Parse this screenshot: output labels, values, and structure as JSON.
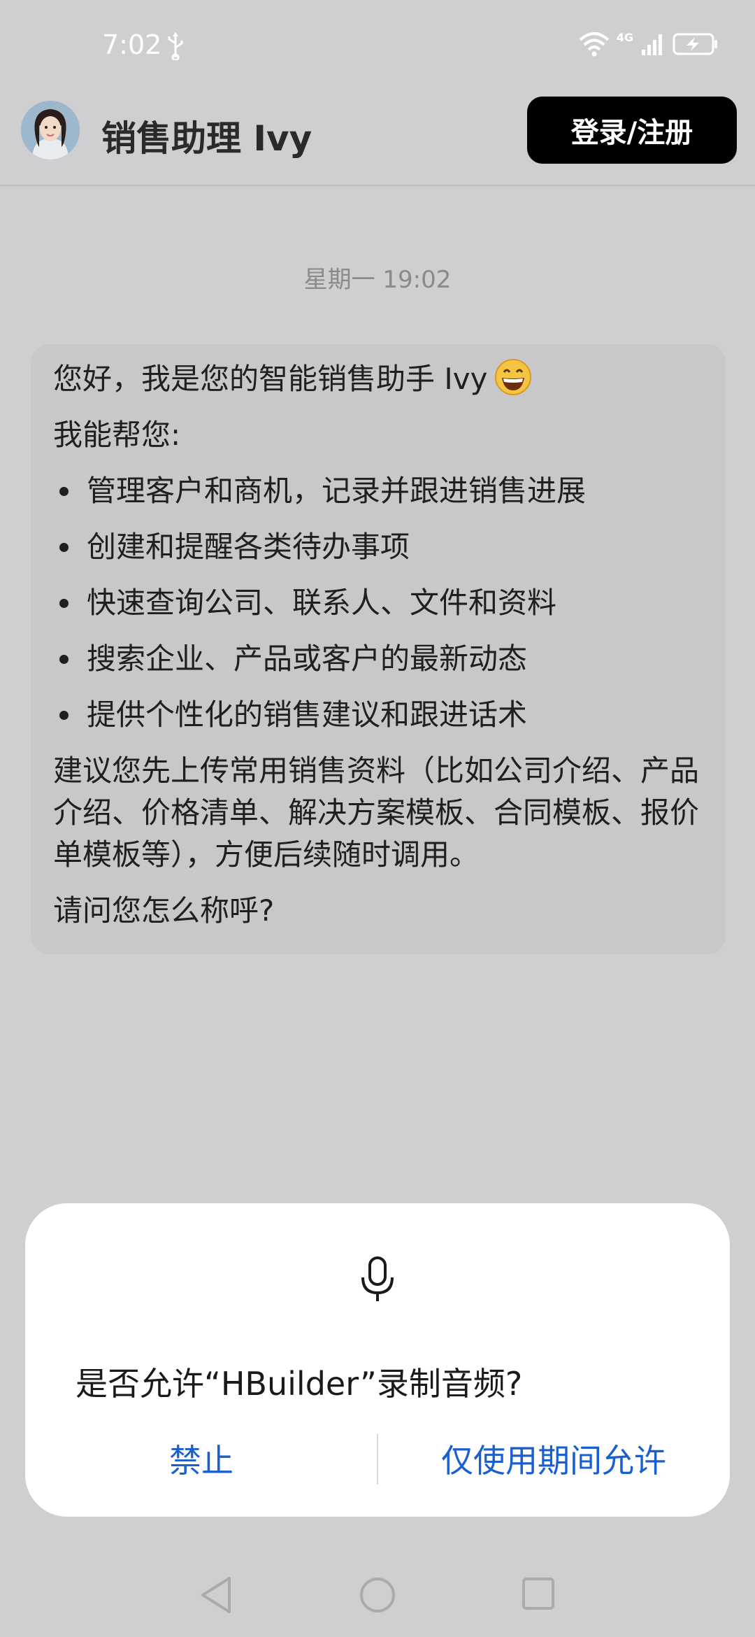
{
  "status_bar": {
    "time": "7:02",
    "network_label": "4G",
    "usb_icon": "usb-icon",
    "wifi_icon": "wifi-icon",
    "signal_icon": "signal-icon",
    "battery_icon": "battery-icon"
  },
  "header": {
    "title": "销售助理 Ivy",
    "login_label": "登录/注册",
    "avatar_icon": "avatar"
  },
  "chat": {
    "timestamp": "星期一 19:02",
    "greeting": "您好，我是您的智能销售助手 Ivy",
    "greeting_emoji": "grinning-face-emoji",
    "intro": "我能帮您:",
    "capabilities": [
      "管理客户和商机，记录并跟进销售进展",
      "创建和提醒各类待办事项",
      "快速查询公司、联系人、文件和资料",
      "搜索企业、产品或客户的最新动态",
      "提供个性化的销售建议和跟进话术"
    ],
    "suggestion": "建议您先上传常用销售资料（比如公司介绍、产品介绍、价格清单、解决方案模板、合同模板、报价单模板等），方便后续随时调用。",
    "question": "请问您怎么称呼?"
  },
  "permission_dialog": {
    "icon": "mic-icon",
    "title": "是否允许“HBuilder”录制音频?",
    "deny_label": "禁止",
    "allow_label": "仅使用期间允许",
    "accent_color": "#1a5fd0"
  },
  "navbar": {
    "back_icon": "nav-back-icon",
    "home_icon": "nav-home-icon",
    "recents_icon": "nav-recents-icon"
  }
}
